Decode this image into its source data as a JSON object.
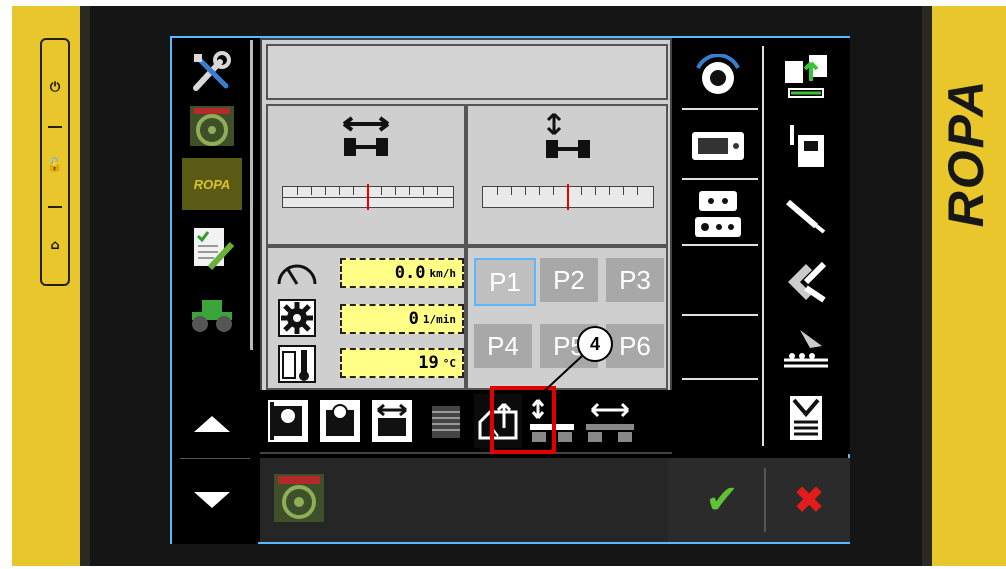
{
  "brand": {
    "text": "ROPA"
  },
  "hardware_keys": {
    "power_icon": "⏻",
    "lock_icon": "🔓",
    "home_icon": "⌂"
  },
  "left_menu": {
    "items": [
      "wrench-screwdriver-icon",
      "steering-wheel-icon",
      "ropa-logo",
      "checklist-icon",
      "tractor-icon"
    ],
    "logo_text": "ROPA"
  },
  "readouts": {
    "speed": {
      "value": "0.0",
      "unit": "km/h"
    },
    "rpm": {
      "value": "0",
      "unit": "1/min"
    },
    "temperature": {
      "value": "19",
      "unit": "°C"
    }
  },
  "presets": [
    "P1",
    "P2",
    "P3",
    "P4",
    "P5",
    "P6"
  ],
  "active_preset": "P1",
  "bottom": {
    "confirm_icon": "✔",
    "cancel_icon": "✖"
  },
  "annotation": {
    "callout_number": "4"
  },
  "colors": {
    "accent": "#5ab8ff",
    "highlight": "#e10000",
    "readout_bg": "#ffff88",
    "confirm": "#5fc234",
    "cancel": "#e21b1b"
  }
}
